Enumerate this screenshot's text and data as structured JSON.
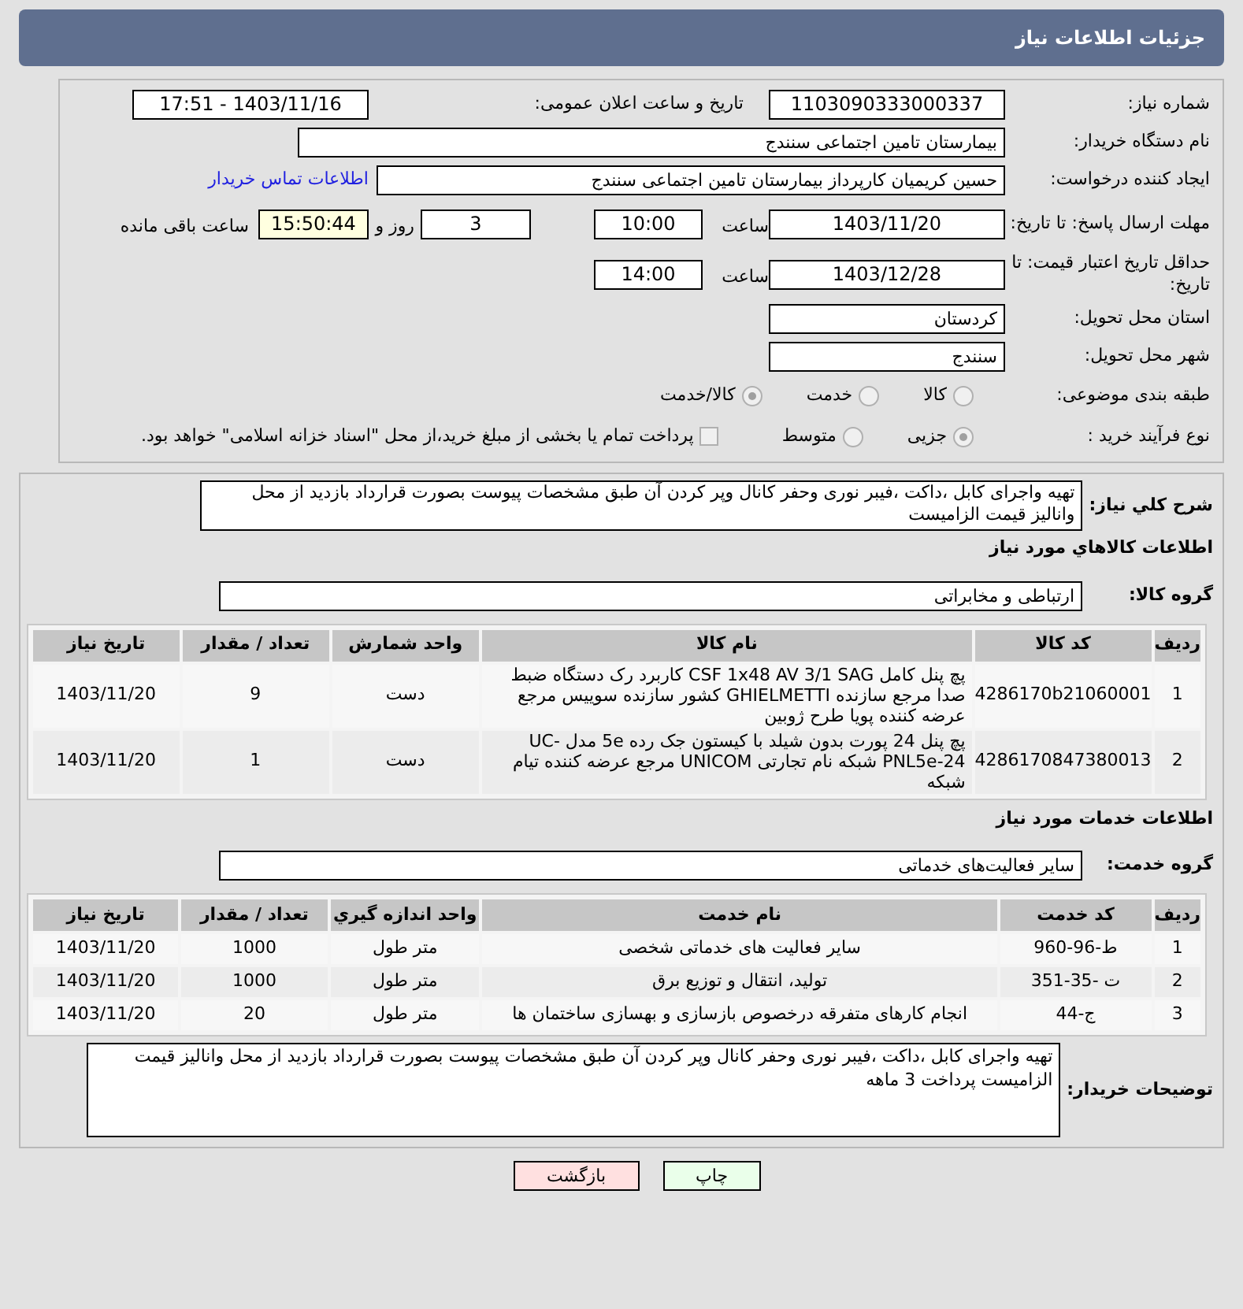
{
  "header": {
    "title": "جزئیات اطلاعات نیاز"
  },
  "need_number": {
    "label": "شماره نیاز:",
    "value": "1103090333000337"
  },
  "announce": {
    "label": "تاریخ و ساعت اعلان عمومی:",
    "value": "1403/11/16 - 17:51"
  },
  "buyer": {
    "label": "نام دستگاه خریدار:",
    "value": "بیمارستان تامین اجتماعی سنندج"
  },
  "requester": {
    "label": "ایجاد کننده درخواست:",
    "value": "حسین کریمیان کارپرداز بیمارستان تامین اجتماعی سنندج",
    "link": "اطلاعات تماس خریدار"
  },
  "reply_deadline": {
    "label": "مهلت ارسال پاسخ: تا تاریخ:",
    "date": "1403/11/20",
    "time_label": "ساعت",
    "time": "10:00",
    "days": "3",
    "days_label": "روز و",
    "remaining": "15:50:44",
    "remaining_label": "ساعت باقی مانده"
  },
  "validity": {
    "label": "حداقل تاریخ اعتبار قیمت: تا تاریخ:",
    "date": "1403/12/28",
    "time_label": "ساعت",
    "time": "14:00"
  },
  "province": {
    "label": "استان محل تحویل:",
    "value": "کردستان"
  },
  "city": {
    "label": "شهر محل تحویل:",
    "value": "سنندج"
  },
  "category": {
    "label": "طبقه بندی موضوعی:",
    "options": [
      {
        "label": "کالا",
        "selected": false
      },
      {
        "label": "خدمت",
        "selected": false
      },
      {
        "label": "کالا/خدمت",
        "selected": true
      }
    ]
  },
  "process": {
    "label": "نوع فرآیند خرید :",
    "options": [
      {
        "label": "جزیی",
        "selected": true
      },
      {
        "label": "متوسط",
        "selected": false
      }
    ],
    "checkbox": {
      "checked": false,
      "label": "پرداخت تمام یا بخشی از مبلغ خرید،از محل \"اسناد خزانه اسلامی\" خواهد بود."
    }
  },
  "description": {
    "label": "شرح کلي نياز:",
    "value": "تهیه واجرای کابل ،داکت ،فیبر نوری وحفر کانال وپر کردن آن طبق مشخصات پیوست بصورت قرارداد بازدید از محل وانالیز قیمت الزامیست"
  },
  "goods": {
    "title": "اطلاعات کالاهاي مورد نياز",
    "group_label": "گروه کالا:",
    "group_value": "ارتباطی و مخابراتی",
    "columns": [
      "رديف",
      "کد کالا",
      "نام کالا",
      "واحد شمارش",
      "تعداد / مقدار",
      "تاريخ نياز"
    ],
    "rows": [
      [
        "1",
        "4286170b21060001",
        "پچ پنل کامل CSF 1x48 AV 3/1 SAG کاربرد رک دستگاه ضبط صدا مرجع سازنده GHIELMETTI کشور سازنده سوییس مرجع عرضه کننده پویا طرح ژوبین",
        "دست",
        "9",
        "1403/11/20"
      ],
      [
        "2",
        "4286170847380013",
        "پچ پنل 24 پورت بدون شیلد با کیستون جک رده 5e مدل UC-PNL5e-24 شبکه نام تجارتی UNICOM مرجع عرضه کننده تیام شبکه",
        "دست",
        "1",
        "1403/11/20"
      ]
    ]
  },
  "services": {
    "title": "اطلاعات خدمات مورد نياز",
    "group_label": "گروه خدمت:",
    "group_value": "سایر فعالیت‌های خدماتی",
    "columns": [
      "رديف",
      "کد خدمت",
      "نام خدمت",
      "واحد اندازه گيري",
      "تعداد / مقدار",
      "تاريخ نياز"
    ],
    "rows": [
      [
        "1",
        "ط-96-960",
        "سایر فعالیت های خدماتی شخصی",
        "متر طول",
        "1000",
        "1403/11/20"
      ],
      [
        "2",
        "ت -35-351",
        "تولید، انتقال و توزیع برق",
        "متر طول",
        "1000",
        "1403/11/20"
      ],
      [
        "3",
        "ج-44",
        "انجام کارهای متفرقه درخصوص بازسازی و بهسازی ساختمان ها",
        "متر طول",
        "20",
        "1403/11/20"
      ]
    ]
  },
  "buyer_notes": {
    "label": "توضیحات خریدار:",
    "value": "تهیه واجرای کابل ،داکت ،فیبر نوری وحفر کانال وپر کردن آن طبق مشخصات پیوست بصورت قرارداد بازدید از محل وانالیز قیمت الزامیست   پرداخت 3 ماهه"
  },
  "buttons": [
    {
      "label": "چاپ",
      "kind": "print"
    },
    {
      "label": "بازگشت",
      "kind": "back"
    }
  ]
}
